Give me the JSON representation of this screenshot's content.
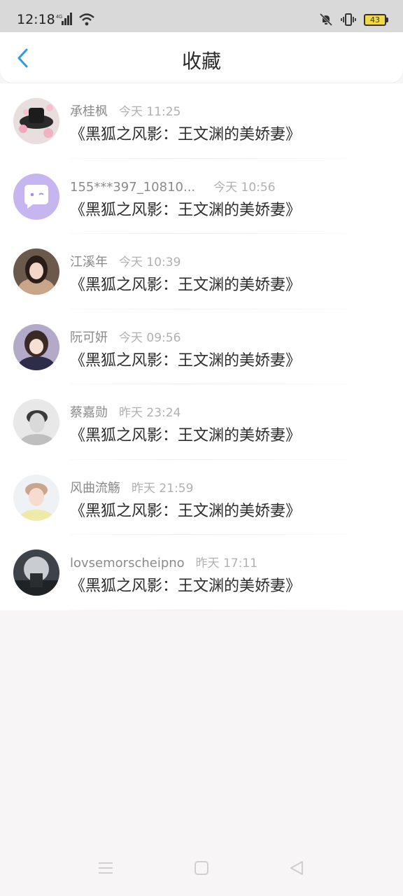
{
  "status": {
    "time": "12:18",
    "network": "4G",
    "battery": "43"
  },
  "header": {
    "title": "收藏"
  },
  "items": [
    {
      "name": "承桂枫",
      "time": "今天 11:25",
      "message": "《黑狐之风影：王文渊的美娇妻》"
    },
    {
      "name": "155***397_10810...",
      "time": "今天 10:56",
      "message": "《黑狐之风影：王文渊的美娇妻》"
    },
    {
      "name": "江溪年",
      "time": "今天 10:39",
      "message": "《黑狐之风影：王文渊的美娇妻》"
    },
    {
      "name": "阮可妍",
      "time": "今天 09:56",
      "message": "《黑狐之风影：王文渊的美娇妻》"
    },
    {
      "name": "蔡嘉勋",
      "time": "昨天 23:24",
      "message": "《黑狐之风影：王文渊的美娇妻》"
    },
    {
      "name": "风曲流觞",
      "time": "昨天 21:59",
      "message": "《黑狐之风影：王文渊的美娇妻》"
    },
    {
      "name": "lovsemorscheipno",
      "time": "昨天 17:11",
      "message": "《黑狐之风影：王文渊的美娇妻》"
    }
  ],
  "colors": {
    "accent": "#2e9ce0",
    "background": "#f7f5f5"
  }
}
